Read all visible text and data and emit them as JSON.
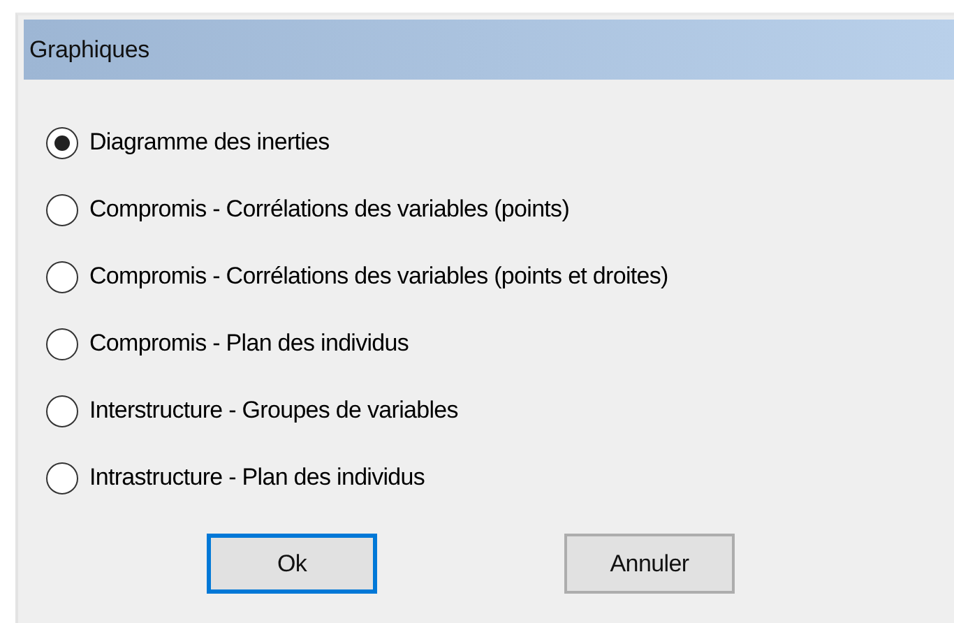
{
  "window": {
    "title": "Graphiques"
  },
  "options": [
    {
      "label": "Diagramme des inerties",
      "selected": true
    },
    {
      "label": "Compromis - Corrélations des variables (points)",
      "selected": false
    },
    {
      "label": "Compromis - Corrélations des variables (points et droites)",
      "selected": false
    },
    {
      "label": "Compromis - Plan des individus",
      "selected": false
    },
    {
      "label": "Interstructure - Groupes de variables",
      "selected": false
    },
    {
      "label": "Intrastructure - Plan des individus",
      "selected": false
    }
  ],
  "buttons": [
    {
      "label": "Ok",
      "default": true
    },
    {
      "label": "Annuler",
      "default": false
    }
  ]
}
